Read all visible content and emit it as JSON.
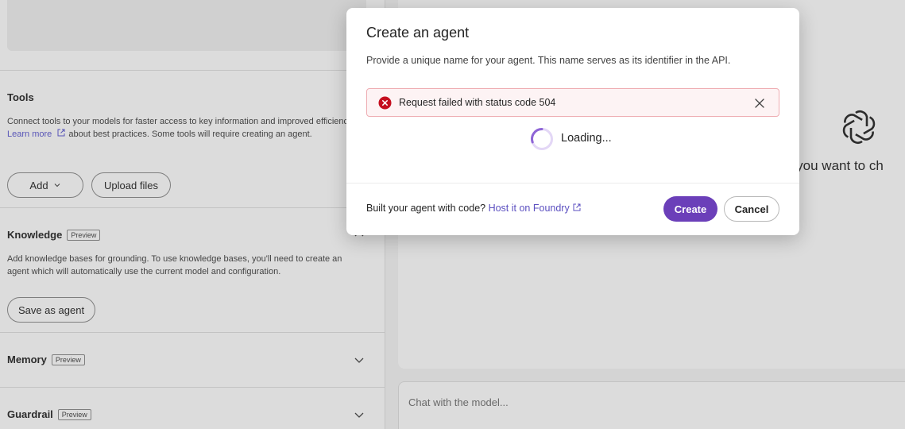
{
  "tools": {
    "title": "Tools",
    "description_before_link": "Connect tools to your models for faster access to key information and improved efficiency.",
    "learn_more_label": "Learn more",
    "description_after_link": "about best practices. Some tools will require creating an agent.",
    "add_label": "Add",
    "upload_label": "Upload files"
  },
  "knowledge": {
    "title": "Knowledge",
    "badge": "Preview",
    "description": "Add knowledge bases for grounding. To use knowledge bases, you'll need to create an agent which will automatically use the current model and configuration.",
    "save_label": "Save as agent"
  },
  "memory": {
    "title": "Memory",
    "badge": "Preview"
  },
  "guardrail": {
    "title": "Guardrail",
    "badge": "Preview"
  },
  "chat": {
    "prompt_fragment": "o you want to ch",
    "input_placeholder": "Chat with the model..."
  },
  "modal": {
    "title": "Create an agent",
    "description": "Provide a unique name for your agent. This name serves as its identifier in the API.",
    "error_message": "Request failed with status code 504",
    "loading_text": "Loading...",
    "footer_prefix": "Built your agent with code?",
    "footer_link": "Host it on Foundry",
    "create_label": "Create",
    "cancel_label": "Cancel"
  },
  "colors": {
    "accent": "#6b3fb9",
    "error": "#c50f1f",
    "link": "#5b57d1"
  },
  "icons": {
    "error": "error-circle-icon",
    "close": "close-icon",
    "spinner": "spinner-icon",
    "external": "external-link-icon",
    "chevron": "chevron-down-icon",
    "logo": "openai-logo-icon"
  }
}
